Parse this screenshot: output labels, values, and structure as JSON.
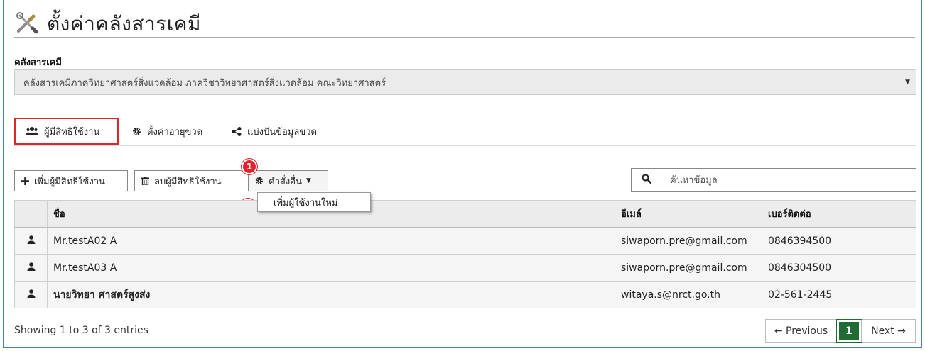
{
  "page": {
    "title": "ตั้งค่าคลังสารเคมี",
    "title_icon": "tools-icon"
  },
  "store": {
    "label": "คลังสารเคมี",
    "selected": "คลังสารเคมีภาควิทยาศาสตร์สิ่งแวดล้อม ภาควิชาวิทยาศาสตร์สิ่งแวดล้อม คณะวิทยาศาสตร์"
  },
  "tabs": [
    {
      "label": "ผู้มีสิทธิใช้งาน",
      "icon": "users-icon",
      "active": true
    },
    {
      "label": "ตั้งค่าอายุขวด",
      "icon": "gear-icon"
    },
    {
      "label": "แบ่งปันข้อมูลขวด",
      "icon": "share-icon"
    }
  ],
  "toolbar": {
    "add_label": "เพิ่มผู้มีสิทธิใช้งาน",
    "delete_label": "ลบผู้มีสิทธิใช้งาน",
    "more_label": "คำสั่งอื่น",
    "dropdown_item": "เพิ่มผู้ใช้งานใหม่"
  },
  "badges": [
    "1",
    "2"
  ],
  "search": {
    "placeholder": "ค้นหาข้อมูล"
  },
  "table": {
    "headers": [
      "",
      "ชื่อ",
      "อีเมล์",
      "เบอร์ติดต่อ"
    ],
    "rows": [
      {
        "name": "Mr.testA02 A",
        "email": "siwaporn.pre@gmail.com",
        "phone": "0846394500"
      },
      {
        "name": "Mr.testA03 A",
        "email": "siwaporn.pre@gmail.com",
        "phone": "0846304500"
      },
      {
        "name": "นายวิทยา ศาสตร์สูงส่ง",
        "email": "witaya.s@nrct.go.th",
        "phone": "02-561-2445"
      }
    ]
  },
  "footer": {
    "info": "Showing 1 to 3 of 3 entries",
    "prev": "← Previous",
    "page": "1",
    "next": "Next →"
  },
  "colors": {
    "active_tab_border": "#e0262b",
    "badge": "#e8202a",
    "page_active": "#1e6b34",
    "frame": "#4a7dbf"
  }
}
